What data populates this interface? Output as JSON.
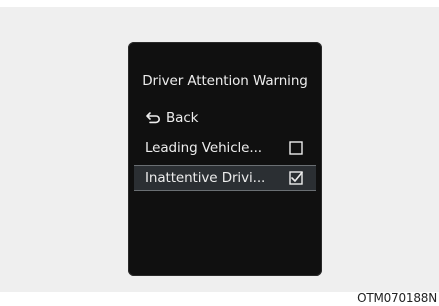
{
  "screen": {
    "title": "Driver Attention Warning",
    "back": {
      "icon": "return-arrow-icon",
      "label": "Back"
    },
    "items": [
      {
        "label": "Leading Vehicle...",
        "checked": false,
        "selected": false
      },
      {
        "label": "Inattentive Drivi...",
        "checked": true,
        "selected": true
      }
    ]
  },
  "figure_code": "OTM070188N",
  "colors": {
    "screen_background": "#101010",
    "selected_row": "#2b2f33",
    "text": "#ededed"
  }
}
